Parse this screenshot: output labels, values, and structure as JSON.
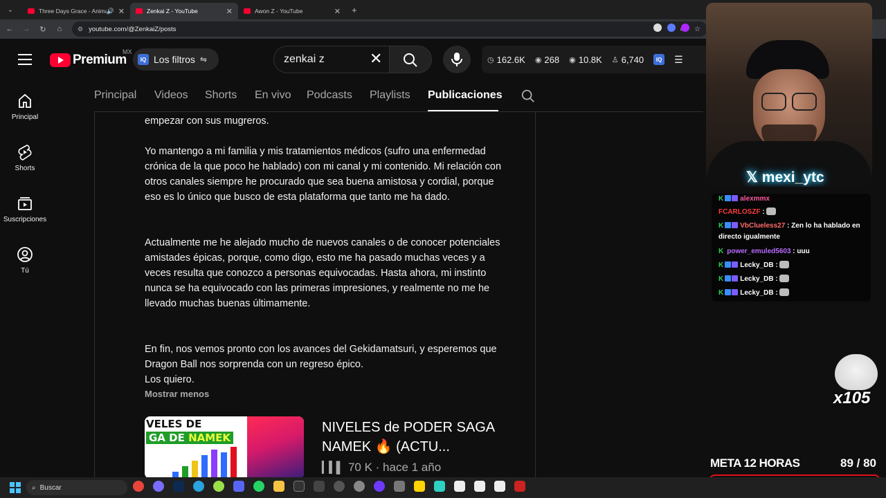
{
  "browser": {
    "tabs": [
      {
        "title": "Three Days Grace - Animal",
        "active": false,
        "muted_icon": true
      },
      {
        "title": "Zenkai Z - YouTube",
        "active": true
      },
      {
        "title": "Awon Z - YouTube",
        "active": false
      }
    ],
    "url": "youtube.com/@ZenkaiZ/posts"
  },
  "header": {
    "logo_text": "Premium",
    "country": "MX",
    "filters_label": "Los filtros",
    "iq_badge": "IQ",
    "search_query": "zenkai z",
    "stats": [
      {
        "icon": "clock-icon",
        "value": "162.6K"
      },
      {
        "icon": "eye-icon",
        "value": "268"
      },
      {
        "icon": "eye-icon",
        "value": "10.8K"
      },
      {
        "icon": "user-icon",
        "value": "6,740"
      }
    ]
  },
  "sidebar": {
    "items": [
      {
        "label": "Principal",
        "icon": "home-icon"
      },
      {
        "label": "Shorts",
        "icon": "shorts-icon"
      },
      {
        "label": "Suscripciones",
        "icon": "subscriptions-icon"
      },
      {
        "label": "Tú",
        "icon": "account-icon"
      }
    ]
  },
  "channel_tabs": [
    {
      "label": "Principal"
    },
    {
      "label": "Videos"
    },
    {
      "label": "Shorts"
    },
    {
      "label": "En vivo"
    },
    {
      "label": "Podcasts"
    },
    {
      "label": "Playlists"
    },
    {
      "label": "Publicaciones",
      "active": true
    }
  ],
  "post": {
    "paragraphs": [
      "empezar con sus mugreros.",
      "Yo mantengo a mi familia y mis tratamientos médicos (sufro una enfermedad crónica de la que poco he hablado) con mi canal y mi contenido. Mi relación con otros canales siempre he procurado que sea buena amistosa y cordial, porque eso es lo único que busco de esta plataforma que tanto me ha dado.",
      "Actualmente me he alejado mucho de nuevos canales o de conocer potenciales amistades épicas, porque, como digo, esto me ha pasado muchas veces y a veces resulta que conozco a personas equivocadas. Hasta ahora, mi instinto nunca se ha equivocado con las primeras impresiones, y realmente no me he llevado muchas buenas últimamente.",
      "En fin, nos vemos pronto con los avances del Gekidamatsuri, y esperemos que Dragon Ball nos sorprenda con un regreso épico.",
      "Los quiero."
    ],
    "show_less": "Mostrar menos",
    "attached_video": {
      "title": "NIVELES de PODER SAGA NAMEK 🔥 (ACTU...",
      "meta": "70 K · hace 1 año",
      "thumb_line1": "VELES DE PODER",
      "thumb_line2a": "GA DE ",
      "thumb_line2b": "NAMEK"
    }
  },
  "stream_overlay": {
    "handle": "mexi_ytc",
    "chat": [
      {
        "user": "alexmmx",
        "color": "#ff5aa0",
        "message": ""
      },
      {
        "user": "FCARLOSZF",
        "color": "#ff3b3b",
        "message": ""
      },
      {
        "user": "VbClueless27",
        "color": "#ff6b6b",
        "message": "Zen lo ha hablado en directo igualmente"
      },
      {
        "user": "power_emuled5603",
        "color": "#b86bff",
        "message": "uuu"
      },
      {
        "user": "Lecky_DB",
        "color": "#ffffff",
        "message": ""
      },
      {
        "user": "Lecky_DB",
        "color": "#ffffff",
        "message": ""
      },
      {
        "user": "Lecky_DB",
        "color": "#ffffff",
        "message": ""
      }
    ],
    "combo": "x105",
    "goal_label": "META 12 HORAS",
    "goal_count": "89 / 80",
    "goal_progress": 1.0
  },
  "taskbar": {
    "search_placeholder": "Buscar"
  }
}
